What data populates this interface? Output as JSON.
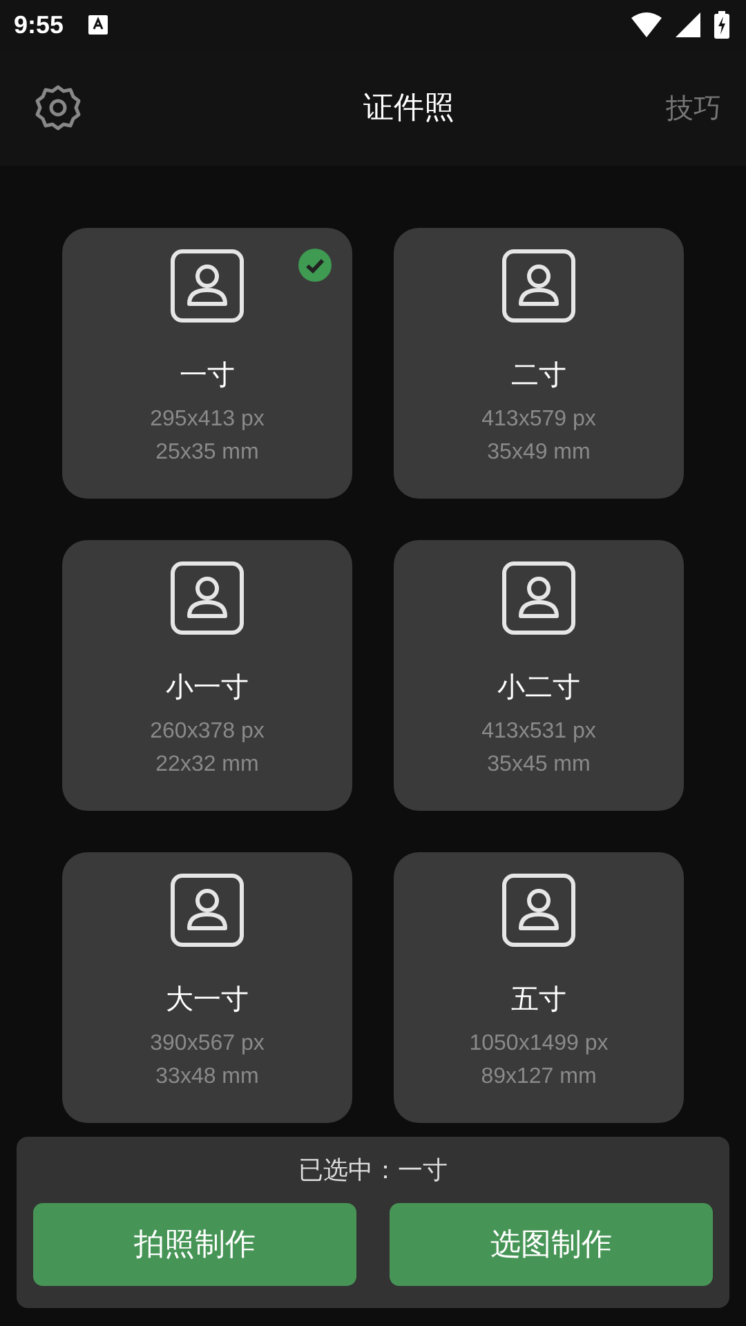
{
  "status_bar": {
    "time": "9:55"
  },
  "app_bar": {
    "title": "证件照",
    "action": "技巧"
  },
  "sizes": [
    {
      "name": "一寸",
      "pixels": "295x413 px",
      "mm": "25x35 mm",
      "selected": true
    },
    {
      "name": "二寸",
      "pixels": "413x579 px",
      "mm": "35x49 mm",
      "selected": false
    },
    {
      "name": "小一寸",
      "pixels": "260x378 px",
      "mm": "22x32 mm",
      "selected": false
    },
    {
      "name": "小二寸",
      "pixels": "413x531 px",
      "mm": "35x45 mm",
      "selected": false
    },
    {
      "name": "大一寸",
      "pixels": "390x567 px",
      "mm": "33x48 mm",
      "selected": false
    },
    {
      "name": "五寸",
      "pixels": "1050x1499 px",
      "mm": "89x127 mm",
      "selected": false
    }
  ],
  "bottom": {
    "selection": "已选中：一寸",
    "buttons": [
      "拍照制作",
      "选图制作"
    ]
  }
}
